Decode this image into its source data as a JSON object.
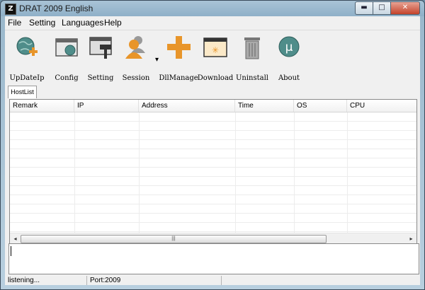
{
  "window": {
    "title": "DRAT 2009 English",
    "app_icon": "app-logo-icon",
    "min_glyph": "▬",
    "max_glyph": "□",
    "close_glyph": "✕"
  },
  "menu": [
    "File",
    "Setting",
    "Languages",
    "Help"
  ],
  "toolbar": {
    "items": [
      {
        "label": "UpDateIp",
        "icon": "globe-plus-icon"
      },
      {
        "label": "Config",
        "icon": "window-globe-icon"
      },
      {
        "label": "Setting",
        "icon": "paint-roller-icon"
      },
      {
        "label": "Session",
        "icon": "users-icon"
      },
      {
        "label": "DllManage",
        "icon": "plus-icon"
      },
      {
        "label": "Download",
        "icon": "download-window-icon"
      },
      {
        "label": "Uninstall",
        "icon": "trash-icon"
      },
      {
        "label": "About",
        "icon": "mu-icon"
      }
    ],
    "session_dropdown_glyph": "▾",
    "about_glyph": "µ"
  },
  "tabs": [
    {
      "label": "HostList",
      "selected": true
    }
  ],
  "hostlist": {
    "columns": [
      "Remark",
      "IP",
      "Address",
      "Time",
      "OS",
      "CPU"
    ],
    "rows": []
  },
  "hscroll": {
    "left_arrow": "◂",
    "right_arrow": "▸",
    "grip": "|||"
  },
  "status": {
    "text": "listening...",
    "port": "Port:2009"
  },
  "colors": {
    "accent_orange": "#e8952a",
    "globe_teal": "#4f8d8a",
    "titlebar": "#9ab8cc"
  }
}
